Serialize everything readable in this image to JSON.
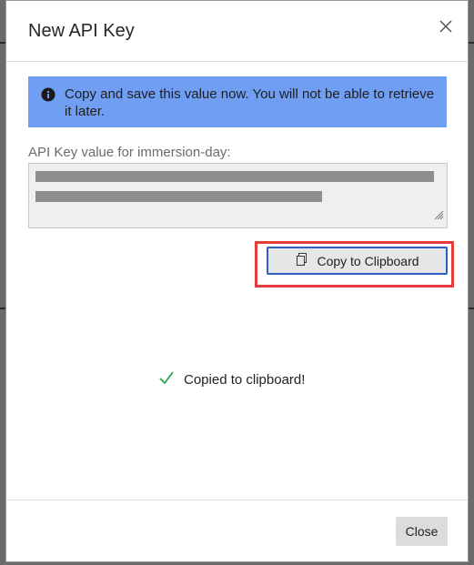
{
  "dialog": {
    "title": "New API Key",
    "close_icon": "close-icon"
  },
  "alert": {
    "icon": "info-icon",
    "text": "Copy and save this value now. You will not be able to retrieve it later.",
    "color": "#6f9ef2"
  },
  "field": {
    "label": "API Key value for immersion-day:",
    "value_redacted": true
  },
  "copy_button": {
    "icon": "copy-icon",
    "label": "Copy to Clipboard",
    "highlight_color": "#e53b3b"
  },
  "status": {
    "icon": "checkmark-icon",
    "text": "Copied to clipboard!",
    "icon_color": "#2aa84a"
  },
  "footer": {
    "close_label": "Close"
  }
}
